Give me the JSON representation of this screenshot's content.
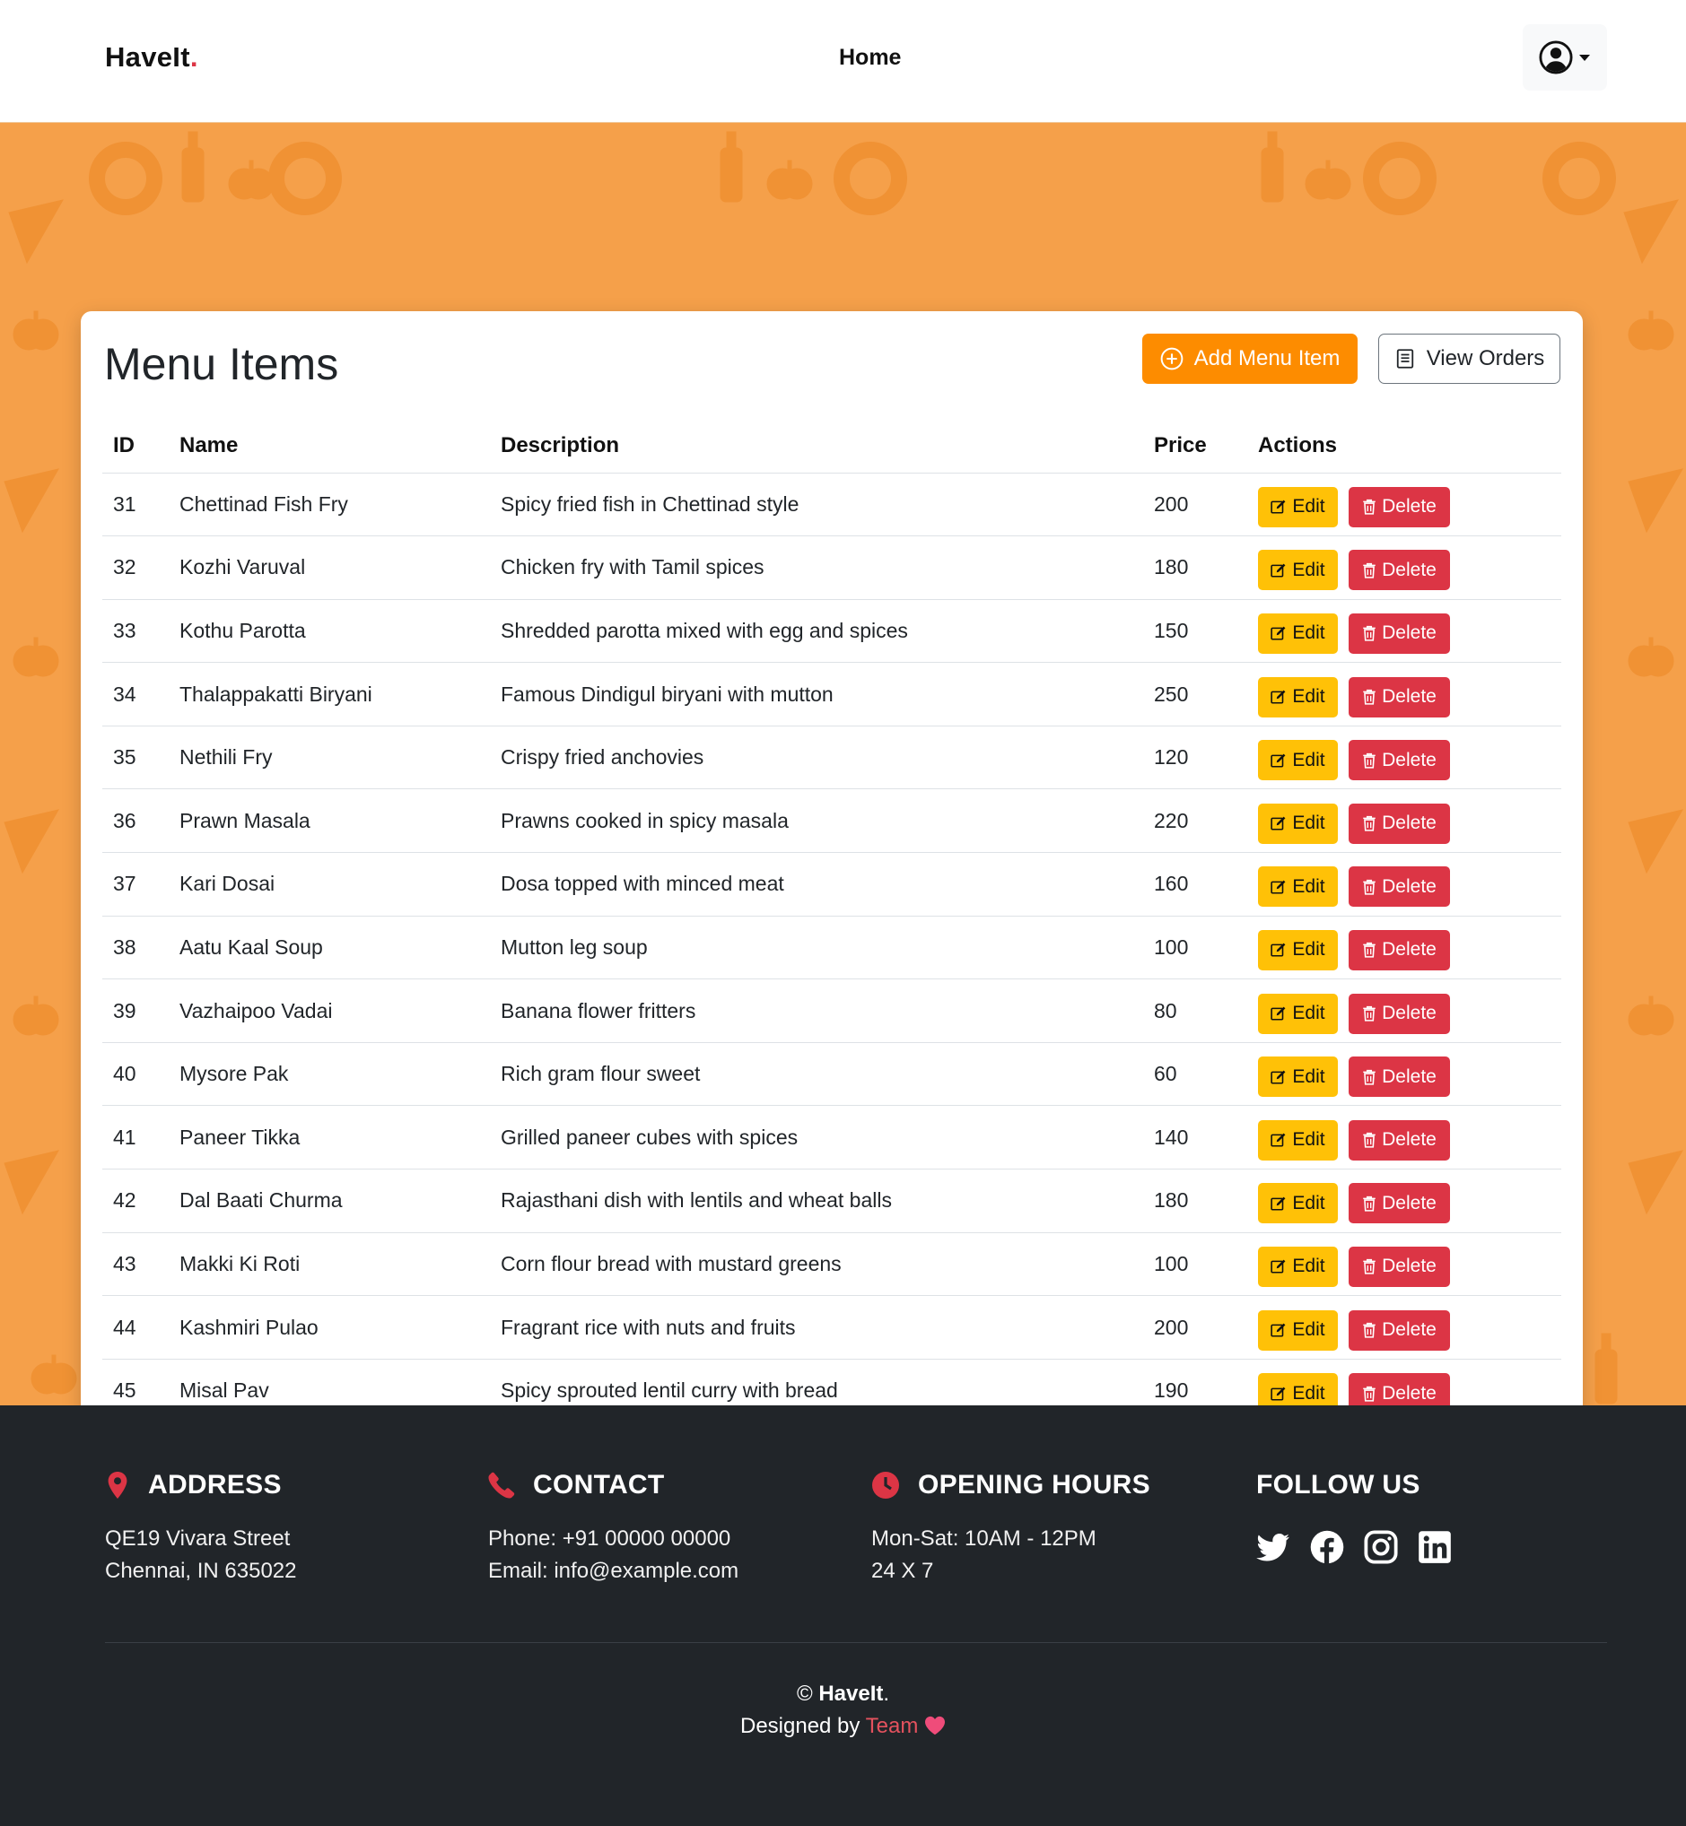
{
  "navbar": {
    "brand": "HaveIt",
    "brand_dot": ".",
    "home": "Home",
    "user_icon": "user-circle-icon"
  },
  "card": {
    "title": "Menu Items",
    "add_button": "Add Menu Item",
    "orders_button": "View Orders",
    "accent_color": "#fd8c00"
  },
  "table": {
    "headers": {
      "id": "ID",
      "name": "Name",
      "description": "Description",
      "price": "Price",
      "actions": "Actions"
    },
    "edit_label": "Edit",
    "delete_label": "Delete",
    "rows": [
      {
        "id": "31",
        "name": "Chettinad Fish Fry",
        "description": "Spicy fried fish in Chettinad style",
        "price": "200"
      },
      {
        "id": "32",
        "name": "Kozhi Varuval",
        "description": "Chicken fry with Tamil spices",
        "price": "180"
      },
      {
        "id": "33",
        "name": "Kothu Parotta",
        "description": "Shredded parotta mixed with egg and spices",
        "price": "150"
      },
      {
        "id": "34",
        "name": "Thalappakatti Biryani",
        "description": "Famous Dindigul biryani with mutton",
        "price": "250"
      },
      {
        "id": "35",
        "name": "Nethili Fry",
        "description": "Crispy fried anchovies",
        "price": "120"
      },
      {
        "id": "36",
        "name": "Prawn Masala",
        "description": "Prawns cooked in spicy masala",
        "price": "220"
      },
      {
        "id": "37",
        "name": "Kari Dosai",
        "description": "Dosa topped with minced meat",
        "price": "160"
      },
      {
        "id": "38",
        "name": "Aatu Kaal Soup",
        "description": "Mutton leg soup",
        "price": "100"
      },
      {
        "id": "39",
        "name": "Vazhaipoo Vadai",
        "description": "Banana flower fritters",
        "price": "80"
      },
      {
        "id": "40",
        "name": "Mysore Pak",
        "description": "Rich gram flour sweet",
        "price": "60"
      },
      {
        "id": "41",
        "name": "Paneer Tikka",
        "description": "Grilled paneer cubes with spices",
        "price": "140"
      },
      {
        "id": "42",
        "name": "Dal Baati Churma",
        "description": "Rajasthani dish with lentils and wheat balls",
        "price": "180"
      },
      {
        "id": "43",
        "name": "Makki Ki Roti",
        "description": "Corn flour bread with mustard greens",
        "price": "100"
      },
      {
        "id": "44",
        "name": "Kashmiri Pulao",
        "description": "Fragrant rice with nuts and fruits",
        "price": "200"
      },
      {
        "id": "45",
        "name": "Misal Pav",
        "description": "Spicy sprouted lentil curry with bread",
        "price": "190"
      }
    ]
  },
  "footer": {
    "address": {
      "title": "ADDRESS",
      "line1": "QE19 Vivara Street",
      "line2": "Chennai, IN 635022",
      "icon": "map-pin-icon"
    },
    "contact": {
      "title": "CONTACT",
      "line1": "Phone: +91 00000 00000",
      "line2": "Email: info@example.com",
      "icon": "phone-icon"
    },
    "hours": {
      "title": "OPENING HOURS",
      "line1": "Mon-Sat: 10AM - 12PM",
      "line2": "24 X 7",
      "icon": "clock-icon"
    },
    "follow": {
      "title": "FOLLOW US",
      "icons": [
        "twitter-icon",
        "facebook-icon",
        "instagram-icon",
        "linkedin-icon"
      ]
    },
    "copyright_symbol": "©",
    "copyright_brand": "HaveIt",
    "copyright_dot": ".",
    "designed_by": "Designed by",
    "team": "Team",
    "accent_red": "#dc3545"
  }
}
